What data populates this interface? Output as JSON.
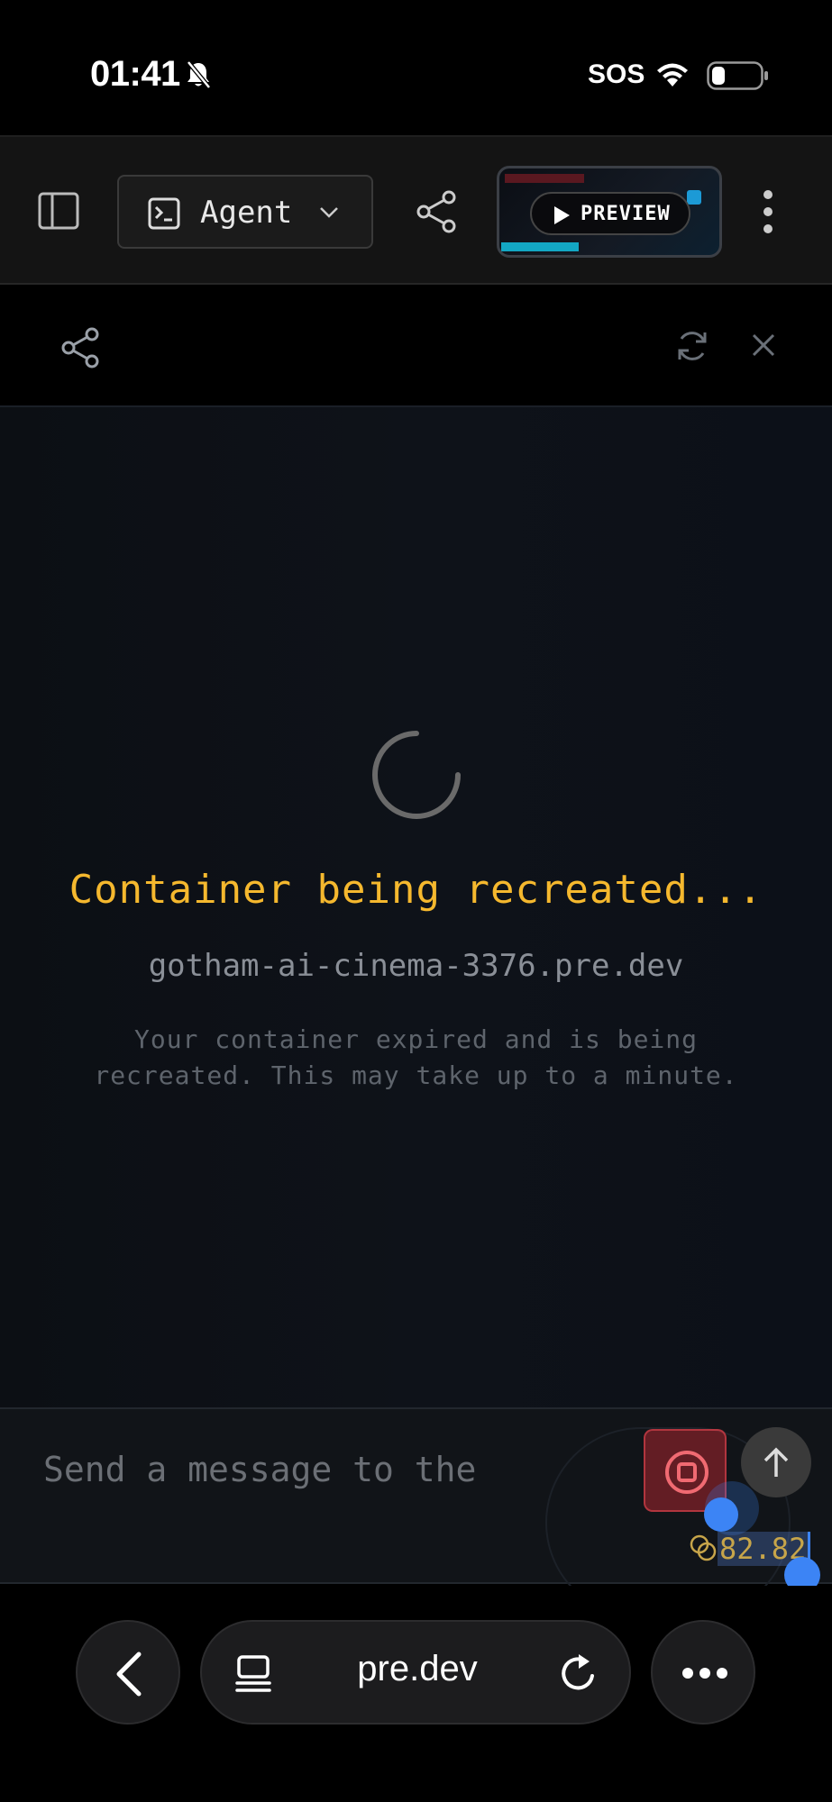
{
  "status_bar": {
    "time": "01:41",
    "carrier": "SOS"
  },
  "top_bar": {
    "agent_label": "Agent",
    "preview_label": "PREVIEW"
  },
  "loading": {
    "title": "Container being recreated...",
    "host": "gotham-ai-cinema-3376.pre.dev",
    "description": "Your container expired and is being recreated. This may take up to a minute."
  },
  "composer": {
    "placeholder": "Send a message to the",
    "credits": "82.82"
  },
  "browser": {
    "url": "pre.dev"
  },
  "colors": {
    "accent_title": "#f5b82e",
    "stop": "#e64650",
    "selection": "#3c84f5"
  }
}
